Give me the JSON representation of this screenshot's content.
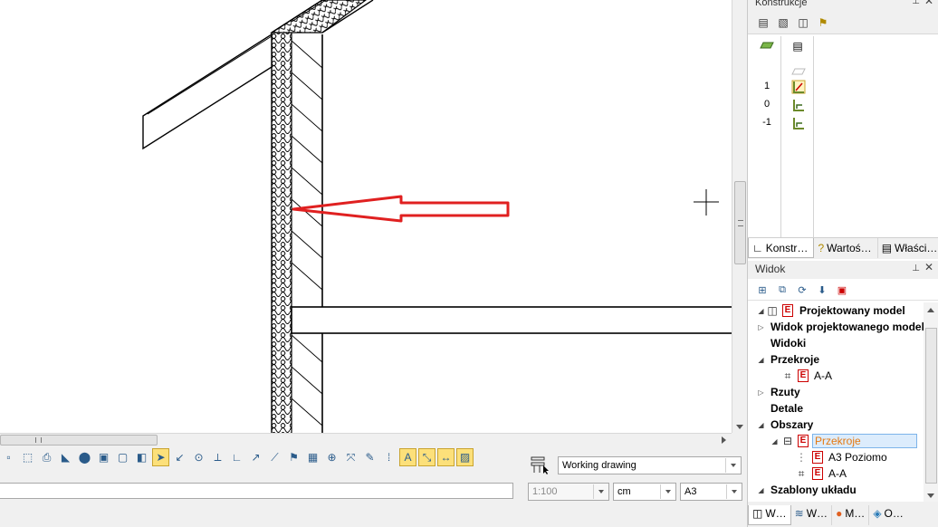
{
  "drawing": {
    "crosshair": "crosshair-cursor"
  },
  "toolbar": {
    "tools": [
      {
        "icon": "window-select-icon",
        "glyph": "▫"
      },
      {
        "icon": "fence-select-icon",
        "glyph": "⬚"
      },
      {
        "icon": "print-icon",
        "glyph": "⎙"
      },
      {
        "icon": "surface-fill-icon",
        "glyph": "◣"
      },
      {
        "icon": "shaded-view-icon",
        "glyph": "⬤"
      },
      {
        "icon": "box-shaded-icon",
        "glyph": "▣"
      },
      {
        "icon": "wireframe-icon",
        "glyph": "▢"
      },
      {
        "icon": "hidden-line-icon",
        "glyph": "◧"
      },
      {
        "icon": "pointer-select-icon",
        "glyph": "➤",
        "active": true
      },
      {
        "icon": "snap-point-icon",
        "glyph": "↙"
      },
      {
        "icon": "snap-center-icon",
        "glyph": "⊙"
      },
      {
        "icon": "snap-intersection-icon",
        "glyph": "⟂"
      },
      {
        "icon": "snap-perpendicular-icon",
        "glyph": "∟"
      },
      {
        "icon": "snap-angle-icon",
        "glyph": "↗"
      },
      {
        "icon": "snap-line-icon",
        "glyph": "⟋"
      },
      {
        "icon": "snap-layer-icon",
        "glyph": "⚑"
      },
      {
        "icon": "grid-icon",
        "glyph": "▦"
      },
      {
        "icon": "snap-object-icon",
        "glyph": "⊕"
      },
      {
        "icon": "snap-track-icon",
        "glyph": "⤧"
      },
      {
        "icon": "snap-node-icon",
        "glyph": "✎"
      },
      {
        "icon": "dotted-grid-icon",
        "glyph": "⁞"
      },
      {
        "icon": "text-snap-icon",
        "glyph": "A",
        "active": true
      },
      {
        "icon": "dimension-snap-icon",
        "glyph": "⤡",
        "active": true
      },
      {
        "icon": "distance-snap-icon",
        "glyph": "↔",
        "active": true
      },
      {
        "icon": "hatch-snap-icon",
        "glyph": "▨",
        "active": true
      }
    ],
    "drawing_type": "Working drawing",
    "scale": "1:100",
    "unit": "cm",
    "format": "A3"
  },
  "konstrukcje": {
    "title": "Konstrukcje",
    "levels": [
      "1",
      "0",
      "-1"
    ],
    "tabs": [
      {
        "label": "Konstr…",
        "icon": "structure-icon"
      },
      {
        "label": "Wartoś…",
        "icon": "help-icon"
      },
      {
        "label": "Właści…",
        "icon": "properties-icon"
      }
    ]
  },
  "widok": {
    "title": "Widok",
    "tree": {
      "root": "Projektowany model",
      "model_view": "Widok projektowanego modelu",
      "views": "Widoki",
      "sections": "Przekroje",
      "section_aa": "A-A",
      "plans": "Rzuty",
      "details": "Detale",
      "areas": "Obszary",
      "areas_sections": "Przekroje",
      "a3_horizontal": "A3 Poziomo",
      "areas_aa": "A-A",
      "layout_templates": "Szablony układu"
    },
    "tabs": [
      {
        "label": "W…",
        "icon": "views-tab-icon"
      },
      {
        "label": "W…",
        "icon": "layers-tab-icon"
      },
      {
        "label": "M…",
        "icon": "materials-tab-icon"
      },
      {
        "label": "O…",
        "icon": "objects-tab-icon"
      }
    ]
  },
  "colors": {
    "arrow": "#e02020",
    "selection_text": "#e47911",
    "active_tool": "#fce07a"
  }
}
